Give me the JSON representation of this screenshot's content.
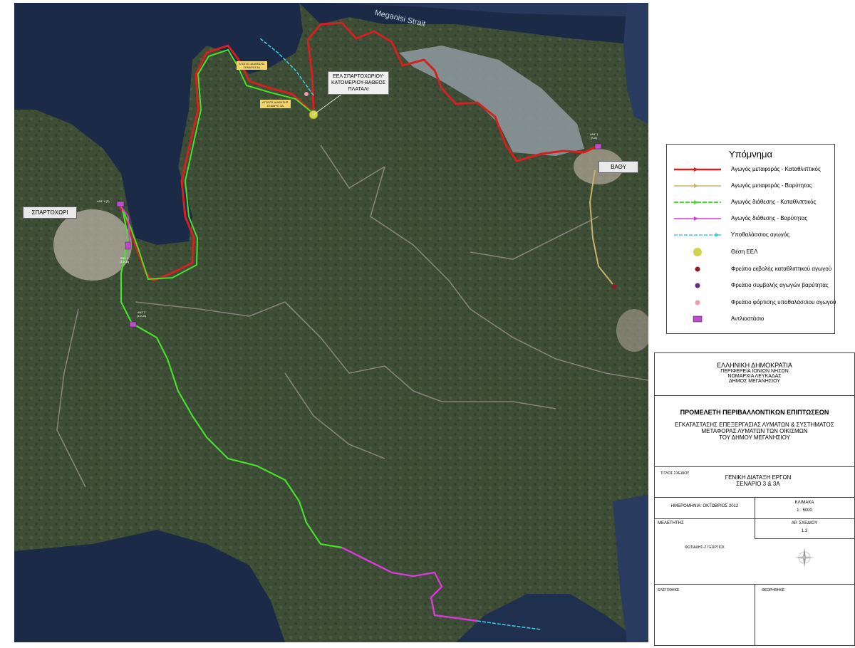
{
  "map": {
    "sea_label": "Meganisi Strait",
    "place_labels": {
      "spartochori": "ΣΠΑΡΤΟΧΩΡΙ",
      "vathy": "ΒΑΘΥ"
    },
    "eel_label_lines": [
      "ΕΕΛ ΣΠΑΡΤΟΧΩΡΙΟΥ-",
      "ΚΑΤΟΜΕΡΙΟΥ-ΒΑΘΕΟΣ",
      "ΠΛΑΤΑΛΙ"
    ],
    "pump_labels": {
      "ps1_top": "ΑΝΣ 1 (Σ)",
      "ps1_mid_a": "ΑΝΣ 1",
      "ps1_mid_b": "(Σ-Κ-Β)",
      "ps2_a": "ΑΝΣ 2",
      "ps2_b": "(Σ-Κ-Β)",
      "vathy_a": "ΑΝΣ 1",
      "vathy_b": "(Κ-Β)"
    },
    "discharge_tags": {
      "upper_a": "ΑΓΩΓΟΣ ΔΙΑΘΕΣΗΣ",
      "upper_b": "ΣΕΝΑΡΙΟ 3Α",
      "lower_a": "ΑΓΩΓΟΣ ΔΙΑΘΕΣΗΣ",
      "lower_b": "ΣΕΝΑΡΙΟ 3Α"
    },
    "colors": {
      "land": "#3b4a33",
      "sea": "#1b2a47",
      "red_line": "#d42020",
      "tan_line": "#c8b26a",
      "green_line": "#46e02c",
      "magenta_line": "#d63cd6",
      "cyan_line": "#3ec8e0",
      "eel_point": "#cfd24b"
    }
  },
  "legend": {
    "title": "Υπόμνημα",
    "items": [
      {
        "label": "Αγωγός μεταφοράς - Καταθλιπτικός",
        "symbol": "red-pressure-main-line"
      },
      {
        "label": "Αγωγός μεταφοράς - Βαρύτητας",
        "symbol": "tan-gravity-main-line"
      },
      {
        "label": "Αγωγός διάθεσης - Καταθλιπτικός",
        "symbol": "green-pressure-disposal-line"
      },
      {
        "label": "Αγωγός διάθεσης - Βαρύτητας",
        "symbol": "magenta-gravity-disposal-line"
      },
      {
        "label": "Υποθαλάσσιος αγωγός",
        "symbol": "cyan-submarine-line"
      },
      {
        "label": "Θέση ΕΕΛ",
        "symbol": "yellow-circle"
      },
      {
        "label": "Φρεάτιο εκβολής καταθλιπτικού αγωγού",
        "symbol": "darkred-dot"
      },
      {
        "label": "Φρεάτιο συμβολής αγωγών βαρύτητας",
        "symbol": "purple-dot"
      },
      {
        "label": "Φρεάτιο φόρτισης υποθαλάσσιου αγωγού",
        "symbol": "pink-dot"
      },
      {
        "label": "Αντλιοστάσιο",
        "symbol": "pump-station-box"
      }
    ]
  },
  "titleblock": {
    "authority": [
      "ΕΛΛΗΝΙΚΗ ΔΗΜΟΚΡΑΤΙΑ",
      "ΠΕΡΙΦΕΡΕΙΑ ΙΟΝΙΩΝ ΝΗΣΩΝ",
      "ΝΟΜΑΡΧΙΑ ΛΕΥΚΑΔΑΣ",
      "ΔΗΜΟΣ ΜΕΓΑΝΗΣΙΟΥ"
    ],
    "study_title": "ΠΡΟΜΕΛΕΤΗ ΠΕΡΙΒΑΛΛΟΝΤΙΚΩΝ ΕΠΙΠΤΩΣΕΩΝ",
    "project_lines": [
      "ΕΓΚΑΤΑΣΤΑΣΗΣ ΕΠΕΞΕΡΓΑΣΙΑΣ ΛΥΜΑΤΩΝ & ΣΥΣΤΗΜΑΤΟΣ",
      "ΜΕΤΑΦΟΡΑΣ ΛΥΜΑΤΩΝ ΤΩΝ ΟΙΚΙΣΜΩΝ",
      "ΤΟΥ ΔΗΜΟΥ ΜΕΓΑΝΗΣΙΟΥ"
    ],
    "drawing_title_label": "ΤΙΤΛΟΣ ΣΧΕΔΙΟΥ",
    "drawing_title_lines": [
      "ΓΕΝΙΚΗ ΔΙΑΤΑΞΗ ΕΡΓΩΝ",
      "ΣΕΝΑΡΙΟ 3 & 3Α"
    ],
    "date": "ΗΜΕΡΟΜΗΝΙΑ: ΟΚΤΩΒΡΙΟΣ 2012",
    "scale_label": "ΚΛΙΜΑΚΑ",
    "scale_value": "1 : 5000",
    "designer_label": "ΜΕΛΕΤΗΤΗΣ",
    "drawing_no_label": "ΑΡ. ΣΧΕΔΙΟΥ",
    "drawing_no_value": "1.3",
    "consultant": "ΦΩΤΙΑΔΗΣ-Ζ ΓΕΩΡΓΙΟΣ",
    "checked_label": "ΕΛΕΓΧΘΗΚΕ",
    "signature_label": "ΘΕΩΡΗΘΗΚΕ"
  }
}
